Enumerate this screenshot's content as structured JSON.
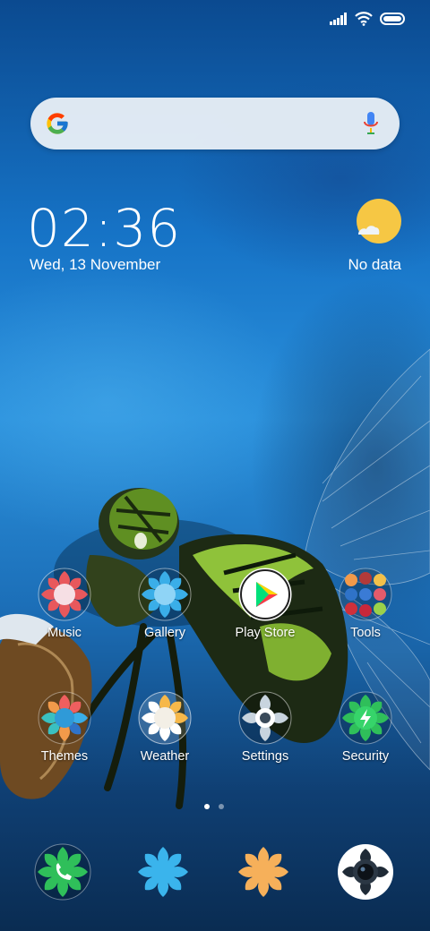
{
  "status_bar": {
    "signal_icon": "signal-icon",
    "wifi_icon": "wifi-icon",
    "battery_icon": "battery-icon"
  },
  "search": {
    "logo": "google-logo-icon",
    "mic": "mic-icon"
  },
  "clock": {
    "time": "02:36",
    "date": "Wed, 13 November"
  },
  "weather": {
    "icon": "partly-sunny-icon",
    "label": "No data"
  },
  "apps_row1": [
    {
      "label": "Music"
    },
    {
      "label": "Gallery"
    },
    {
      "label": "Play Store"
    },
    {
      "label": "Tools"
    }
  ],
  "apps_row2": [
    {
      "label": "Themes"
    },
    {
      "label": "Weather"
    },
    {
      "label": "Settings"
    },
    {
      "label": "Security"
    }
  ],
  "page_indicator": {
    "pages": 2,
    "current": 1
  },
  "dock": [
    {
      "icon": "phone-icon"
    },
    {
      "icon": "messages-icon"
    },
    {
      "icon": "browser-icon"
    },
    {
      "icon": "camera-icon"
    }
  ],
  "colors": {
    "search_bg": "#f0f4f8",
    "sun": "#f6c744",
    "wallpaper_blue": "#1a6fc0"
  }
}
